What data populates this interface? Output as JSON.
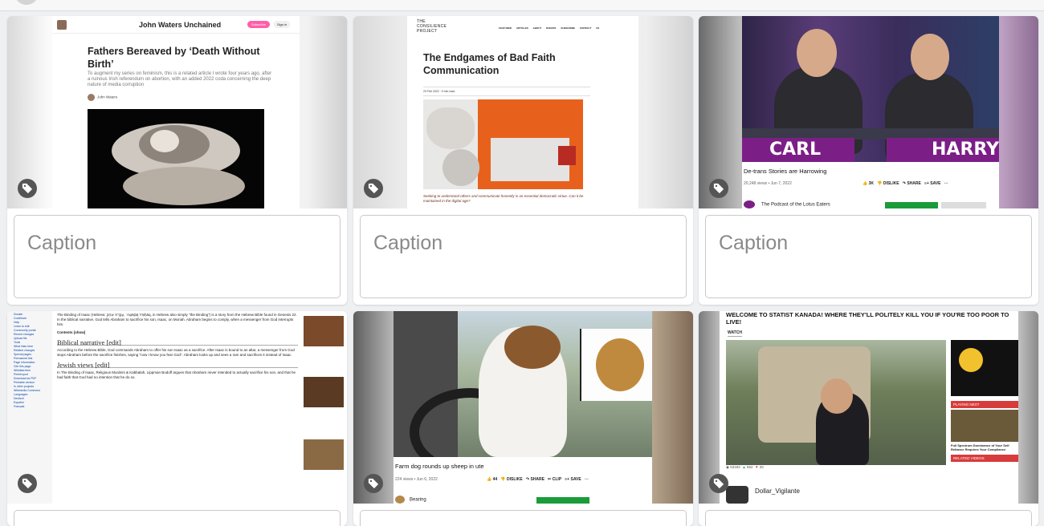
{
  "cards": [
    {
      "site": "John Waters Unchained",
      "subscribe": "Subscribe",
      "signin": "Sign in",
      "title": "Fathers Bereaved by ‘Death Without Birth’",
      "subtitle": "To augment my series on feminism, this is a related article I wrote four years ago, after a ruinous Irish referendum on abortion, with an added 2022 coda concerning the deep nature of media corruption",
      "author": "John Waters",
      "caption": "Caption"
    },
    {
      "logo_line1": "THE",
      "logo_line2": "CONSILIENCE",
      "logo_line3": "PROJECT",
      "nav": "FEATURED ARTICLES  ABOUT  DONATE  SUBSCRIBE  CONTACT US",
      "title": "The Endgames of Bad Faith Communication",
      "meta": "23 Feb 2022 · 9 min read",
      "quote": "Seeking to understand others and communicate honestly is an essential democratic virtue. Can it be maintained in the digital age?",
      "caption": "Caption"
    },
    {
      "name_left": "CARL",
      "name_right": "HARRY",
      "title": "De-trans Stories are Harrowing",
      "meta": "20,248 views • Jun 7, 2022",
      "likes": "3K",
      "dislike": "DISLIKE",
      "share": "SHARE",
      "save": "SAVE",
      "channel": "The Podcast of the Lotus Eaters",
      "caption": "Caption"
    },
    {
      "side_links": [
        "Donate",
        "Contribute",
        "Help",
        "Learn to edit",
        "Community portal",
        "Recent changes",
        "Upload file",
        "Tools",
        "What links here",
        "Related changes",
        "Special pages",
        "Permanent link",
        "Page information",
        "Cite this page",
        "Wikidata item",
        "Print/export",
        "Download as PDF",
        "Printable version",
        "In other projects",
        "Wikimedia Commons",
        "Languages",
        "Deutsch",
        "Español",
        "Français"
      ],
      "intro": "The Binding of Isaac (Hebrew: עֲקֵדַת יִצְחָק, ʿAqēḏaṯ Yīṣḥāq, in Hebrew also simply \"the Binding\") is a story from the Hebrew Bible found in Genesis 22. In the biblical narrative, God tells Abraham to sacrifice his son, Isaac, on Moriah. Abraham begins to comply, when a messenger from God interrupts him.",
      "contents": "Contents [show]",
      "h1": "Biblical narrative [edit]",
      "p1": "According to the Hebrew Bible, God commands Abraham to offer his son Isaac as a sacrifice. After Isaac is bound to an altar, a messenger from God stops Abraham before the sacrifice finishes, saying \"now I know you fear God\". Abraham looks up and sees a ram and sacrifices it instead of Isaac.",
      "h2": "Jewish views [edit]",
      "p2": "In The Binding of Isaac, Religious Murders & Kabbalah, Lippman Bodoff argues that Abraham never intended to actually sacrifice his son, and that he had faith that God had no intention that he do so."
    },
    {
      "title": "Farm dog rounds up sheep in ute",
      "meta": "224 views • Jun 6, 2022",
      "likes": "44",
      "dislike": "DISLIKE",
      "share": "SHARE",
      "clip": "CLIP",
      "save": "SAVE",
      "channel": "Bearing"
    },
    {
      "title": "WELCOME TO STATIST KANADA! WHERE THEY'LL POLITELY KILL YOU IF YOU'RE TOO POOR TO LIVE!",
      "watch": "WATCH",
      "playing_next": "PLAYING NEXT",
      "next_title": "Full Spectrum Dominance of Your Self Reliance Requires Your Compliance",
      "related": "RELATED VIDEOS",
      "views": "53182",
      "upvotes": "662",
      "downvotes": "26",
      "channel": "Dollar_Vigilante"
    }
  ],
  "colors": {
    "caption_text": "#8a8a8a",
    "tag_bg": "#555555",
    "yt_sub": "#1a9c3a",
    "lotus_purple": "#7b1f86",
    "rumble_red": "#d83b3b"
  }
}
